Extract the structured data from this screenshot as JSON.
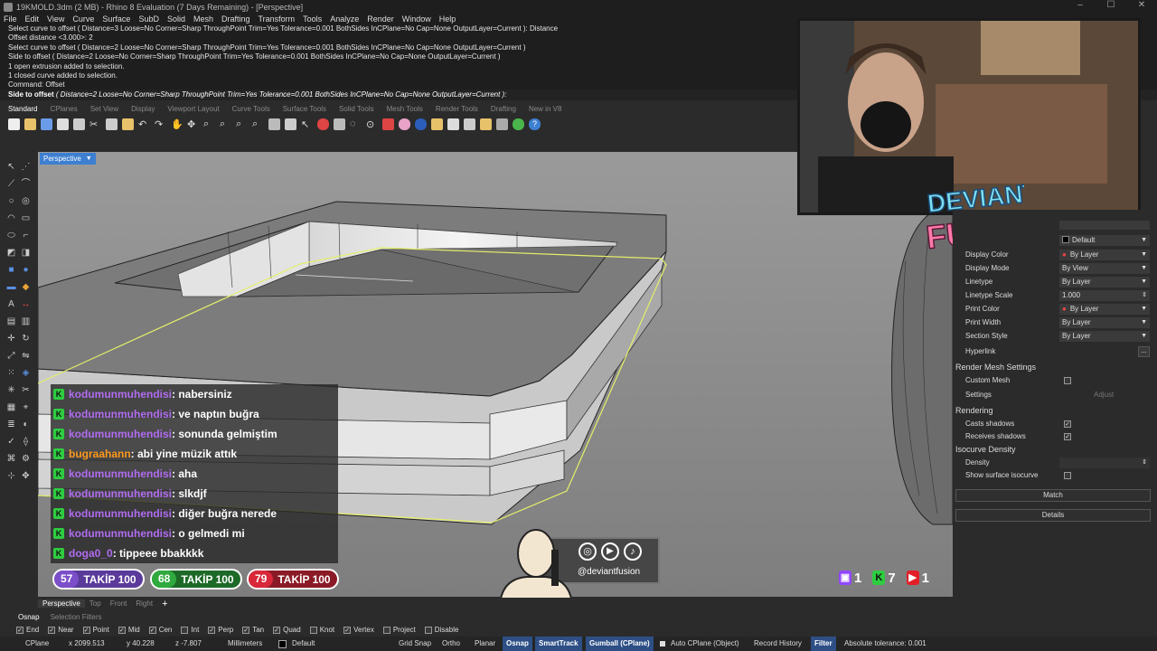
{
  "window": {
    "title": "19KMOLD.3dm (2 MB) - Rhino 8 Evaluation (7 Days Remaining) - [Perspective]"
  },
  "menu": [
    "File",
    "Edit",
    "View",
    "Curve",
    "Surface",
    "SubD",
    "Solid",
    "Mesh",
    "Drafting",
    "Transform",
    "Tools",
    "Analyze",
    "Render",
    "Window",
    "Help"
  ],
  "command_history": [
    "Select curve to offset ( Distance=3  Loose=No  Corner=Sharp  ThroughPoint  Trim=Yes  Tolerance=0.001  BothSides  InCPlane=No  Cap=None  OutputLayer=Current ): Distance",
    "Offset distance <3.000>: 2",
    "Select curve to offset ( Distance=2  Loose=No  Corner=Sharp  ThroughPoint  Trim=Yes  Tolerance=0.001  BothSides  InCPlane=No  Cap=None  OutputLayer=Current )",
    "Side to offset ( Distance=2  Loose=No  Corner=Sharp  ThroughPoint  Trim=Yes  Tolerance=0.001  BothSides  InCPlane=No  Cap=None  OutputLayer=Current )",
    "1 open extrusion added to selection.",
    "1 closed curve added to selection.",
    "Command: Offset"
  ],
  "command_prompt": {
    "label": "Side to offset",
    "options": "( Distance=2  Loose=No  Corner=Sharp  ThroughPoint  Trim=Yes  Tolerance=0.001  BothSides  InCPlane=No  Cap=None  OutputLayer=Current ):"
  },
  "toolbar_tabs": [
    "Standard",
    "CPlanes",
    "Set View",
    "Display",
    "Viewport Layout",
    "Curve Tools",
    "Surface Tools",
    "Solid Tools",
    "Mesh Tools",
    "Render Tools",
    "Drafting",
    "New in V8"
  ],
  "viewport": {
    "label": "Perspective"
  },
  "viewport_tabs": [
    "Perspective",
    "Top",
    "Front",
    "Right"
  ],
  "add_viewport_glyph": "+",
  "properties": {
    "layer_value": "Default",
    "rows": [
      {
        "label": "Display Color",
        "value": "By Layer"
      },
      {
        "label": "Display Mode",
        "value": "By View"
      },
      {
        "label": "Linetype",
        "value": "By Layer"
      },
      {
        "label": "Linetype Scale",
        "value": "1.000"
      },
      {
        "label": "Print Color",
        "value": "By Layer"
      },
      {
        "label": "Print Width",
        "value": "By Layer"
      },
      {
        "label": "Section Style",
        "value": "By Layer"
      },
      {
        "label": "Hyperlink",
        "value": "..."
      }
    ],
    "render_mesh_section": "Render Mesh Settings",
    "custom_mesh_label": "Custom Mesh",
    "settings_label": "Settings",
    "adjust_label": "Adjust",
    "rendering_section": "Rendering",
    "casts_shadows_label": "Casts shadows",
    "receives_shadows_label": "Receives shadows",
    "isocurve_section": "Isocurve Density",
    "density_label": "Density",
    "show_isocurve_label": "Show surface isocurve",
    "match_button": "Match",
    "details_button": "Details"
  },
  "stream": {
    "logo_line1": "DEVIANT",
    "logo_line2": "FUSION",
    "handle": "@deviantfusion",
    "chat": [
      {
        "user": "kodumunmuhendisi",
        "message": ": nabersiniz",
        "color": "purple"
      },
      {
        "user": "kodumunmuhendisi",
        "message": ": ve naptın buğra",
        "color": "purple"
      },
      {
        "user": "kodumunmuhendisi",
        "message": ": sonunda gelmiştim",
        "color": "purple"
      },
      {
        "user": "bugraahann",
        "message": ": abi yine müzik attık",
        "color": "orange"
      },
      {
        "user": "kodumunmuhendisi",
        "message": ": aha",
        "color": "purple"
      },
      {
        "user": "kodumunmuhendisi",
        "message": ": slkdjf",
        "color": "purple"
      },
      {
        "user": "kodumunmuhendisi",
        "message": ": diğer buğra nerede",
        "color": "purple"
      },
      {
        "user": "kodumunmuhendisi",
        "message": ": o gelmedi mi",
        "color": "purple"
      },
      {
        "user": "doga0_0",
        "message": ": tippeee bbakkkk",
        "color": "purple"
      }
    ],
    "goals": [
      {
        "count": "57",
        "label": "TAKİP 100",
        "color": "#7b4fc9"
      },
      {
        "count": "68",
        "label": "TAKİP 100",
        "color": "#2faa3e"
      },
      {
        "count": "79",
        "label": "TAKİP 100",
        "color": "#d8283a"
      }
    ],
    "platform_counts": [
      {
        "icon": "twitch-icon",
        "count": "1"
      },
      {
        "icon": "kick-icon",
        "count": "7"
      },
      {
        "icon": "youtube-icon",
        "count": "1"
      }
    ]
  },
  "osnap": {
    "tabs": [
      "Osnap",
      "Selection Filters"
    ],
    "snaps": [
      {
        "label": "End",
        "checked": true
      },
      {
        "label": "Near",
        "checked": true
      },
      {
        "label": "Point",
        "checked": true
      },
      {
        "label": "Mid",
        "checked": true
      },
      {
        "label": "Cen",
        "checked": true
      },
      {
        "label": "Int",
        "checked": false
      },
      {
        "label": "Perp",
        "checked": true
      },
      {
        "label": "Tan",
        "checked": true
      },
      {
        "label": "Quad",
        "checked": true
      },
      {
        "label": "Knot",
        "checked": false
      },
      {
        "label": "Vertex",
        "checked": true
      },
      {
        "label": "Project",
        "checked": false
      },
      {
        "label": "Disable",
        "checked": false
      }
    ]
  },
  "status": {
    "cplane": "CPlane",
    "x": "x 2099.513",
    "y": "y 40.228",
    "z": "z -7.807",
    "units": "Millimeters",
    "layer": "Default",
    "grid_snap": "Grid Snap",
    "ortho": "Ortho",
    "planar": "Planar",
    "osnap": "Osnap",
    "smarttrack": "SmartTrack",
    "gumball": "Gumball (CPlane)",
    "auto_cplane": "Auto CPlane (Object)",
    "record_history": "Record History",
    "filter": "Filter",
    "tolerance": "Absolute tolerance: 0.001"
  },
  "colors": {
    "accent": "#3d7fd1",
    "selection": "#e4ef6a",
    "kick": "#2ecc40"
  }
}
